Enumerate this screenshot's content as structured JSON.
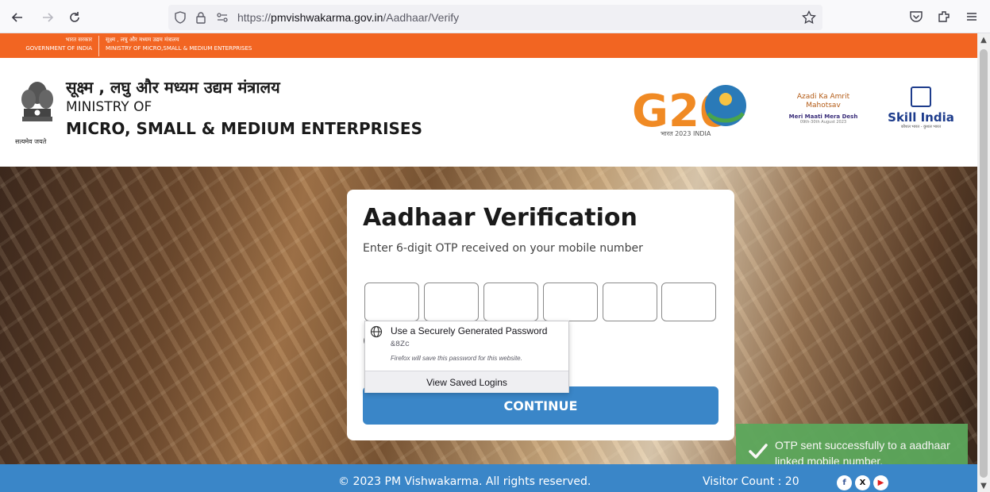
{
  "browser": {
    "url_scheme": "https://",
    "url_host": "pmvishwakarma.gov.in",
    "url_path": "/Aadhaar/Verify",
    "icons": [
      "back-icon",
      "forward-icon",
      "reload-icon",
      "shield-icon",
      "lock-icon",
      "permissions-icon",
      "bookmark-star-icon",
      "pocket-icon",
      "extensions-icon",
      "menu-icon"
    ]
  },
  "gov_strip": {
    "left_hindi": "भारत सरकार",
    "left_english": "GOVERNMENT OF INDIA",
    "right_hindi": "सूक्ष्म , लघु और मध्यम उद्यम मंत्रालय",
    "right_english": "MINISTRY OF MICRO,SMALL & MEDIUM ENTERPRISES",
    "color": "#f26522"
  },
  "header": {
    "emblem_motto": "सत्यमेव जयते",
    "ministry_hindi": "सूक्ष्म , लघु और मध्यम उद्यम मंत्रालय",
    "ministry_of": "MINISTRY OF",
    "ministry_name": "MICRO, SMALL & MEDIUM ENTERPRISES",
    "g20_text": "G20",
    "g20_sub": "भारत 2023 INDIA",
    "azadi_title": "Azadi Ka Amrit Mahotsav",
    "azadi_sub": "Meri Maati Mera Desh",
    "azadi_date": "09th-30th August 2023",
    "skill_name": "Skill India",
    "skill_sub": "कौशल भारत - कुशल भारत"
  },
  "card": {
    "title": "Aadhaar Verification",
    "subtitle": "Enter 6-digit OTP received on your mobile number",
    "otp_values": [
      "",
      "",
      "",
      "",
      "",
      ""
    ],
    "partial_text": "(",
    "continue_label": "CONTINUE",
    "accent": "#3a86c8"
  },
  "password_popup": {
    "title": "Use a Securely Generated Password",
    "value": "&8Zc",
    "note": "Firefox will save this password for this website.",
    "saved_logins": "View Saved Logins"
  },
  "toast": {
    "message": "OTP sent successfully to a aadhaar linked mobile number.",
    "color": "#5ca85c"
  },
  "footer": {
    "copyright": "© 2023 PM Vishwakarma. All rights reserved.",
    "visitor_label": "Visitor Count : 20",
    "social": [
      "f",
      "X",
      "▶"
    ]
  }
}
